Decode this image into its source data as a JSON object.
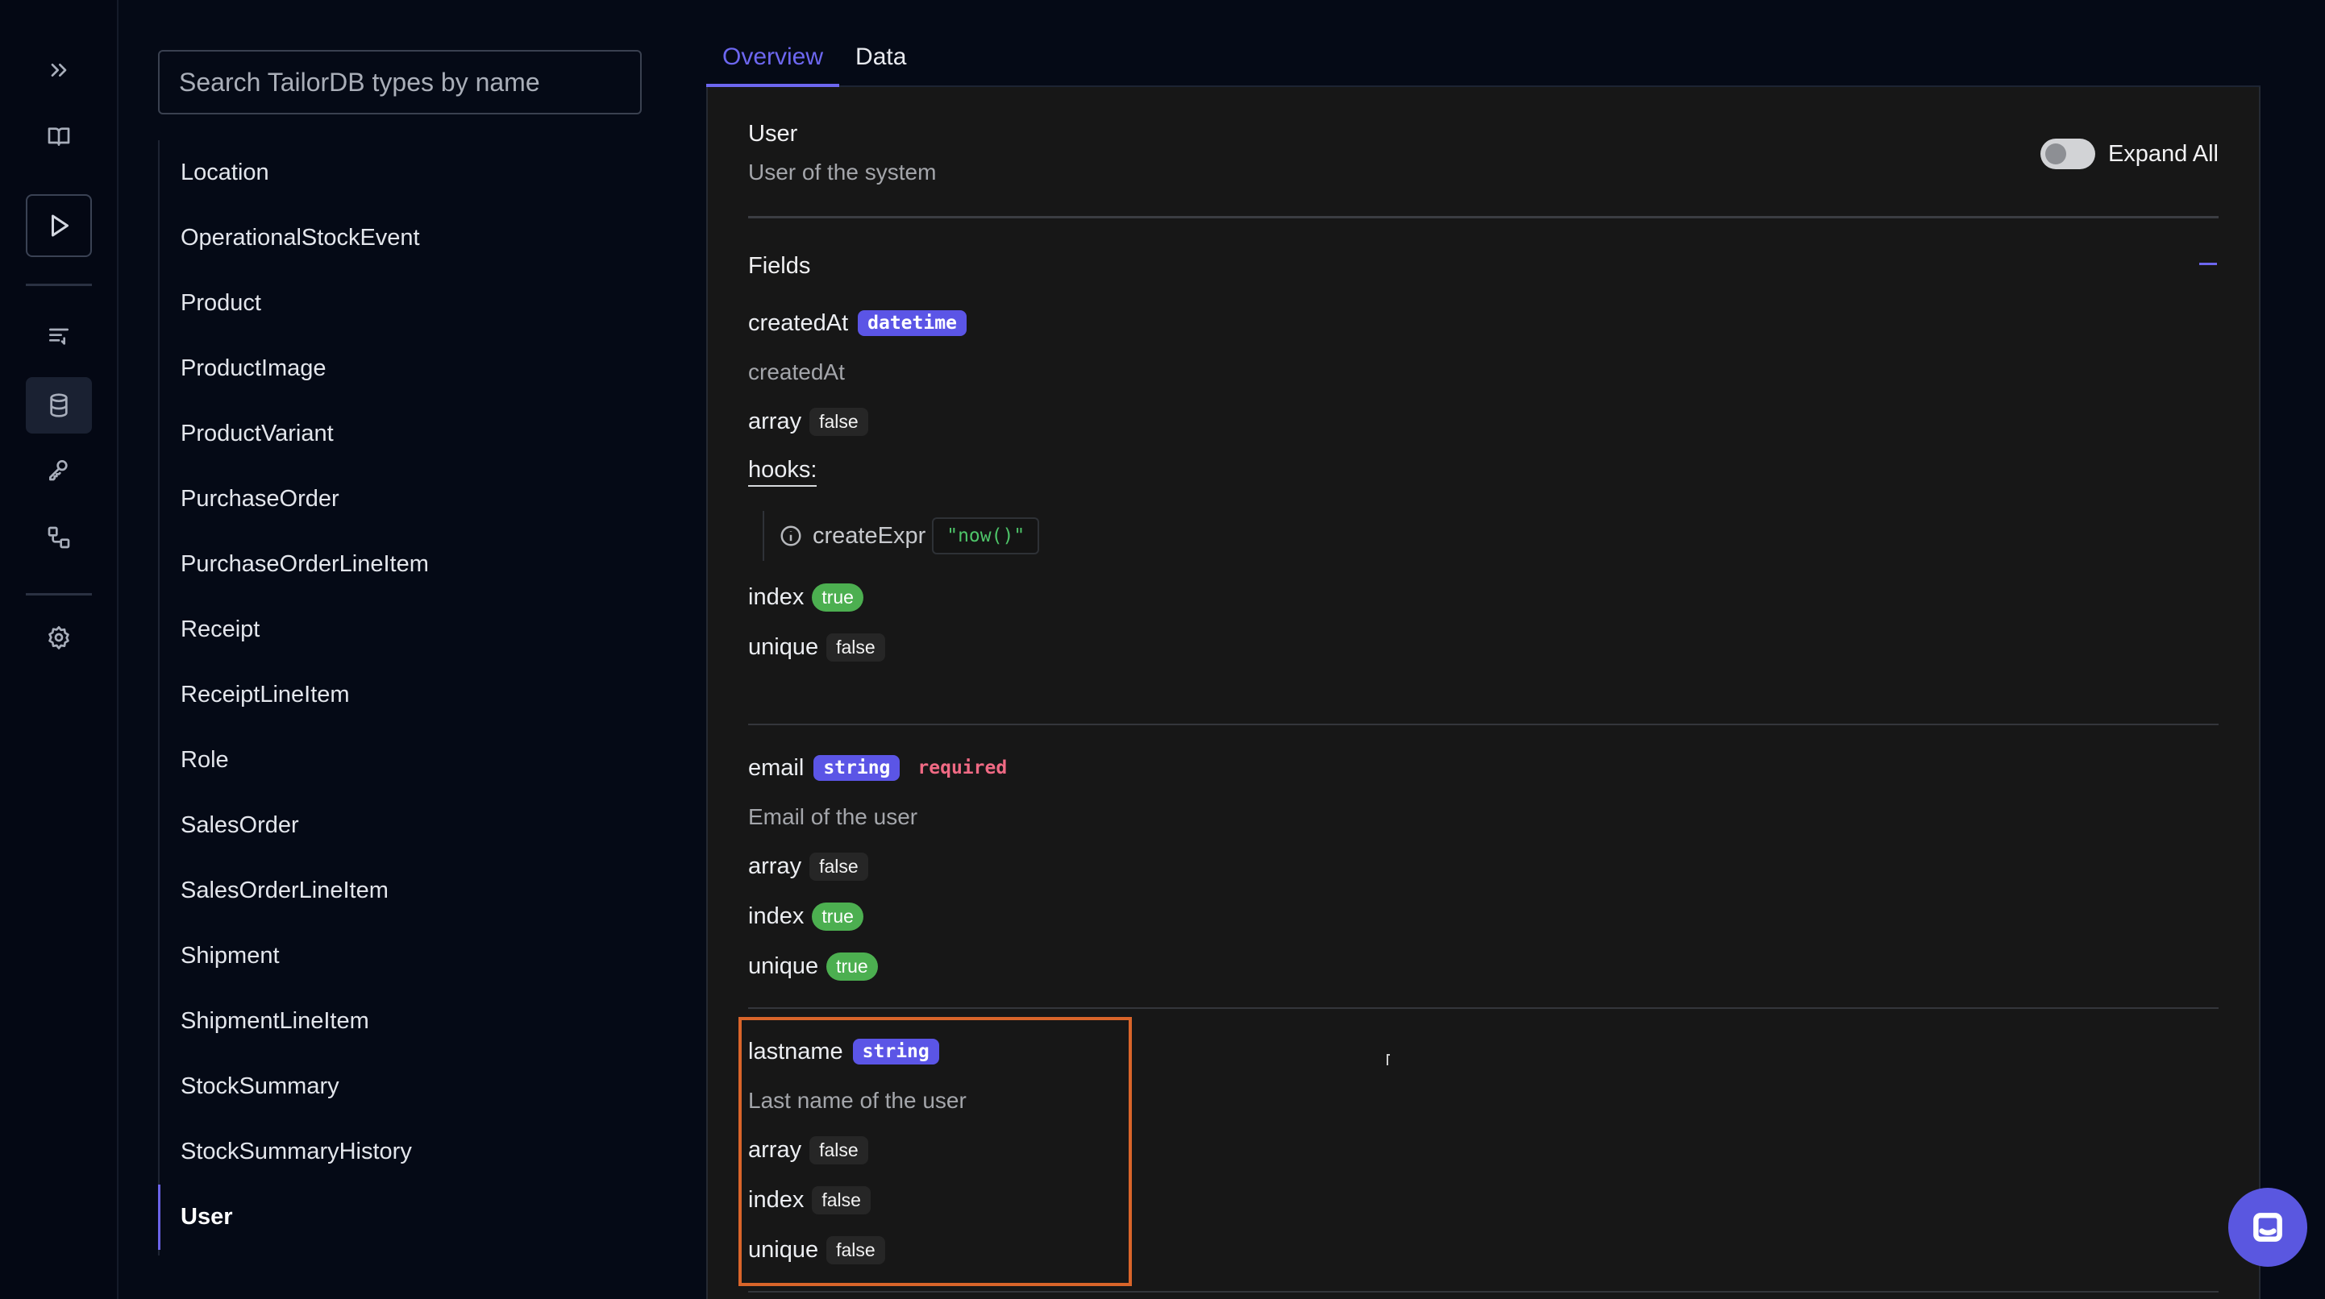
{
  "rail": {
    "icons": [
      "expand-icon",
      "book-icon",
      "play-icon",
      "list-icon",
      "database-icon",
      "key-icon",
      "workflow-icon",
      "settings-icon"
    ]
  },
  "search": {
    "placeholder": "Search TailorDB types by name",
    "value": ""
  },
  "types": [
    "Location",
    "OperationalStockEvent",
    "Product",
    "ProductImage",
    "ProductVariant",
    "PurchaseOrder",
    "PurchaseOrderLineItem",
    "Receipt",
    "ReceiptLineItem",
    "Role",
    "SalesOrder",
    "SalesOrderLineItem",
    "Shipment",
    "ShipmentLineItem",
    "StockSummary",
    "StockSummaryHistory",
    "User"
  ],
  "selected_type": "User",
  "tabs": {
    "overview": "Overview",
    "data": "Data"
  },
  "detail": {
    "title": "User",
    "description": "User of the system",
    "expand_all": "Expand All",
    "fields_heading": "Fields",
    "created_at": {
      "name": "createdAt",
      "type": "datetime",
      "description": "createdAt",
      "array_label": "array",
      "array_value": "false",
      "hooks_label": "hooks:",
      "hook_name": "createExpr",
      "hook_value": "\"now()\"",
      "index_label": "index",
      "index_value": "true",
      "unique_label": "unique",
      "unique_value": "false"
    },
    "email": {
      "name": "email",
      "type": "string",
      "required": "required",
      "description": "Email of the user",
      "array_label": "array",
      "array_value": "false",
      "index_label": "index",
      "index_value": "true",
      "unique_label": "unique",
      "unique_value": "true"
    },
    "lastname": {
      "name": "lastname",
      "type": "string",
      "description": "Last name of the user",
      "array_label": "array",
      "array_value": "false",
      "index_label": "index",
      "index_value": "false",
      "unique_label": "unique",
      "unique_value": "false"
    }
  },
  "colors": {
    "accent": "#6d67f0",
    "true_badge": "#4caf50",
    "required": "#f06a84",
    "highlight": "#d9652a"
  }
}
